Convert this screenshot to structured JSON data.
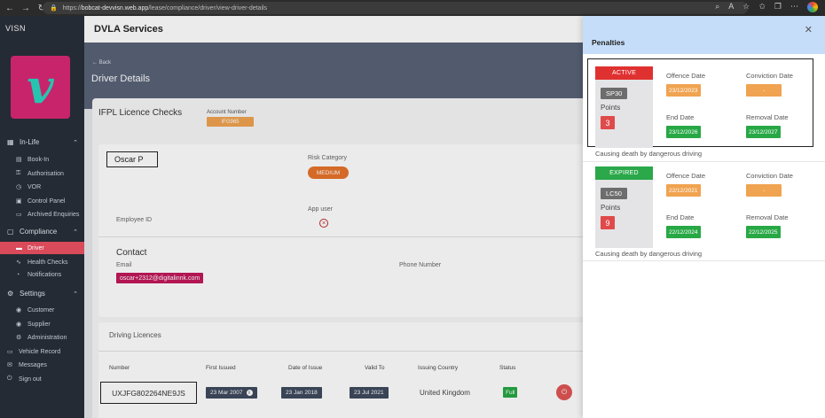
{
  "browser": {
    "url_prefix": "https://",
    "url_host": "bobcat-devvisn.web.app",
    "url_path": "/lease/compliance/driver/view-driver-details"
  },
  "sidebar": {
    "brand": "VISN",
    "logo_letter": "v",
    "sections": [
      {
        "label": "In-Life",
        "items": [
          "Book-In",
          "Authorisation",
          "VOR",
          "Control Panel",
          "Archived Enquiries"
        ]
      },
      {
        "label": "Compliance",
        "items": [
          "Driver",
          "Health Checks",
          "Notifications"
        ]
      },
      {
        "label": "Settings",
        "items": [
          "Customer",
          "Supplier",
          "Administration"
        ]
      }
    ],
    "bottom_items": [
      "Vehicle Record",
      "Messages",
      "Sign out"
    ]
  },
  "header": {
    "title": "DVLA Services"
  },
  "banner": {
    "back": "Back",
    "title": "Driver Details"
  },
  "card": {
    "heading": "IFPL Licence Checks",
    "account_label": "Account Number",
    "account_value": "IFG965"
  },
  "driver": {
    "name": "Oscar P",
    "risk_label": "Risk Category",
    "risk_value": "MEDIUM",
    "employee_label": "Employee ID",
    "app_user_label": "App user",
    "contact_heading": "Contact",
    "email_label": "Email",
    "email_value": "oscar+2312@digitalinnk.com",
    "phone_label": "Phone Number"
  },
  "licences": {
    "heading": "Driving Licences",
    "columns": [
      "Number",
      "First Issued",
      "Date of Issue",
      "Valid To",
      "Issuing Country",
      "Status"
    ],
    "rows": [
      {
        "number": "UXJFG802264NE9JS",
        "first_issued": "23 Mar 2007",
        "date_of_issue": "23 Jan 2018",
        "valid_to": "23 Jul 2021",
        "country": "United Kingdom",
        "status": "Full"
      }
    ]
  },
  "penalties": {
    "title": "Penalties",
    "labels": {
      "points": "Points",
      "offence_date": "Offence Date",
      "conviction_date": "Conviction Date",
      "end_date": "End Date",
      "removal_date": "Removal Date"
    },
    "items": [
      {
        "state": "ACTIVE",
        "state_color": "#e03131",
        "code": "SP30",
        "points": "3",
        "offence_date": "23/12/2023",
        "conviction_date": "-",
        "end_date": "23/12/2026",
        "removal_date": "23/12/2027",
        "description": "Causing death by dangerous driving"
      },
      {
        "state": "EXPIRED",
        "state_color": "#2aa84a",
        "code": "LC50",
        "points": "9",
        "offence_date": "22/12/2021",
        "conviction_date": "-",
        "end_date": "22/12/2024",
        "removal_date": "22/12/2025",
        "description": "Causing death by dangerous driving"
      }
    ]
  },
  "colors": {
    "accent": "#c2185b",
    "orange": "#f0a350",
    "green": "#27a845"
  }
}
